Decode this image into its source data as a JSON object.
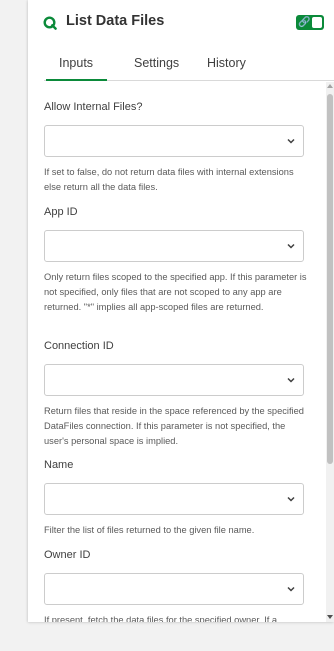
{
  "header": {
    "title": "List Data Files",
    "icon": "qlik-logo-icon",
    "toggle_icon": "link-icon",
    "toggle_state": "on"
  },
  "tabs": [
    {
      "label": "Inputs",
      "active": true
    },
    {
      "label": "Settings",
      "active": false
    },
    {
      "label": "History",
      "active": false
    }
  ],
  "fields": [
    {
      "label": "Allow Internal Files?",
      "value": "",
      "help": "If set to false, do not return data files with internal extensions else return all the data files."
    },
    {
      "label": "App ID",
      "value": "",
      "help": "Only return files scoped to the specified app. If this parameter is not specified, only files that are not scoped to any app are returned. \"*\" implies all app-scoped files are returned."
    },
    {
      "label": "Connection ID",
      "value": "",
      "help": "Return files that reside in the space referenced by the specified DataFiles connection. If this parameter is not specified, the user's personal space is implied."
    },
    {
      "label": "Name",
      "value": "",
      "help": "Filter the list of files returned to the given file name."
    },
    {
      "label": "Owner ID",
      "value": "",
      "help": "If present, fetch the data files for the specified owner. If a"
    }
  ],
  "colors": {
    "accent": "#0b8a3a",
    "panel": "#ffffff",
    "background": "#f2f2f2"
  }
}
